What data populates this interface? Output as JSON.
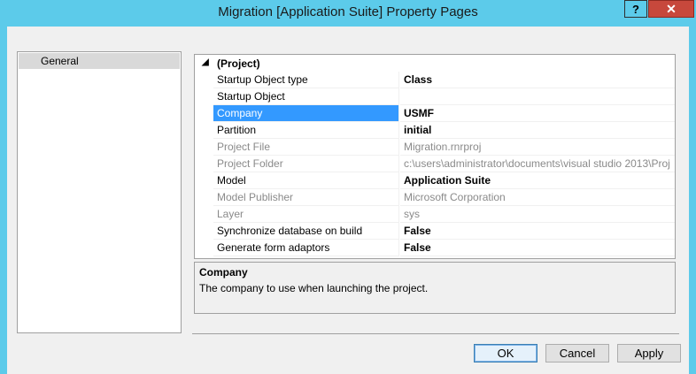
{
  "window": {
    "title": "Migration [Application Suite] Property Pages",
    "help_label": "?",
    "close_label": "✕"
  },
  "nav": {
    "items": [
      {
        "label": "General"
      }
    ]
  },
  "grid": {
    "category": {
      "label": "(Project)",
      "expander": "◢"
    },
    "rows": [
      {
        "name": "Startup Object type",
        "value": "Class",
        "style": "bold"
      },
      {
        "name": "Startup Object",
        "value": "",
        "style": "normal"
      },
      {
        "name": "Company",
        "value": "USMF",
        "style": "bold",
        "selected": true
      },
      {
        "name": "Partition",
        "value": "initial",
        "style": "bold"
      },
      {
        "name": "Project File",
        "value": "Migration.rnrproj",
        "style": "gray"
      },
      {
        "name": "Project Folder",
        "value": "c:\\users\\administrator\\documents\\visual studio 2013\\Proj",
        "style": "gray"
      },
      {
        "name": "Model",
        "value": "Application Suite",
        "style": "bold"
      },
      {
        "name": "Model Publisher",
        "value": "Microsoft Corporation",
        "style": "gray"
      },
      {
        "name": "Layer",
        "value": "sys",
        "style": "gray"
      },
      {
        "name": "Synchronize database on build",
        "value": "False",
        "style": "bold"
      },
      {
        "name": "Generate form adaptors",
        "value": "False",
        "style": "bold"
      }
    ]
  },
  "description": {
    "title": "Company",
    "text": "The company to use when launching the project."
  },
  "buttons": {
    "ok": "OK",
    "cancel": "Cancel",
    "apply": "Apply"
  }
}
